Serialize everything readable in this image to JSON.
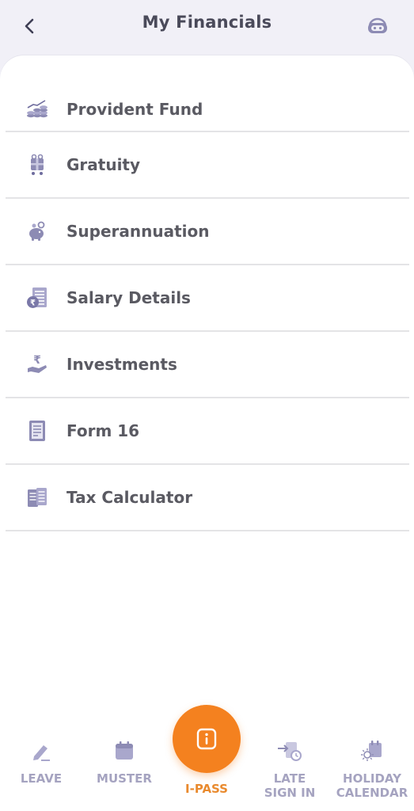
{
  "header": {
    "title": "My Financials",
    "back_icon": "chevron-left-icon",
    "support_icon": "chatbot-headset-icon"
  },
  "menu": {
    "items": [
      {
        "label": "Provident Fund",
        "icon": "coins-growth-icon"
      },
      {
        "label": "Gratuity",
        "icon": "gift-cart-icon"
      },
      {
        "label": "Superannuation",
        "icon": "piggy-bank-icon"
      },
      {
        "label": "Salary Details",
        "icon": "rupee-document-icon"
      },
      {
        "label": "Investments",
        "icon": "rupee-hand-icon"
      },
      {
        "label": "Form 16",
        "icon": "form-document-icon"
      },
      {
        "label": "Tax Calculator",
        "icon": "tax-documents-icon"
      }
    ]
  },
  "bottom_nav": {
    "leave": "LEAVE",
    "muster": "MUSTER",
    "ipass": "I-PASS",
    "late_sign_in_1": "LATE",
    "late_sign_in_2": "SIGN IN",
    "holiday_1": "HOLIDAY",
    "holiday_2": "CALENDAR"
  },
  "colors": {
    "accent": "#f4811f",
    "icon": "#8d8bb4",
    "nav_label": "#a5a3c0",
    "text": "#5a5a62"
  }
}
